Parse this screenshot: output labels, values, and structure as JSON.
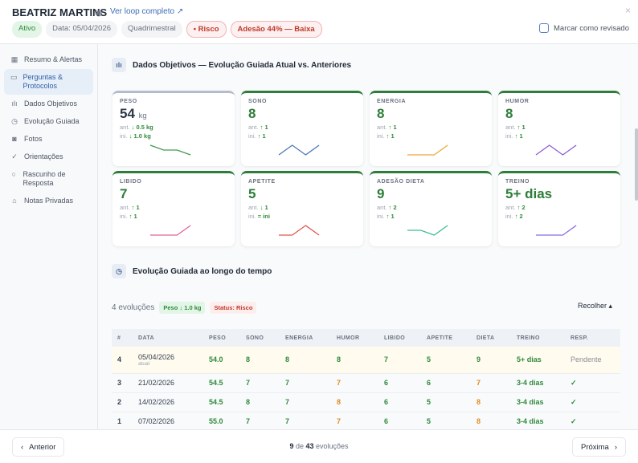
{
  "header": {
    "name": "BEATRIZ MARTINS",
    "loop_link": "Ver loop completo ↗",
    "badges": [
      {
        "text": "Ativo",
        "kind": "g"
      },
      {
        "text": "Data: 05/04/2026",
        "kind": ""
      },
      {
        "text": "Quadrimestral",
        "kind": ""
      },
      {
        "text": "• Risco",
        "kind": "r"
      },
      {
        "text": "Adesão 44% — Baixa",
        "kind": "r"
      }
    ],
    "review_label": "Marcar como revisado",
    "close": "×"
  },
  "sidebar": {
    "items": [
      {
        "icon": "calendar",
        "glyph": "▦",
        "label": "Resumo & Alertas"
      },
      {
        "icon": "message",
        "glyph": "▭",
        "label": "Perguntas & Protocolos",
        "active": true
      },
      {
        "icon": "bar-chart",
        "glyph": "ılı",
        "label": "Dados Objetivos"
      },
      {
        "icon": "clock",
        "glyph": "◷",
        "label": "Evolução Guiada"
      },
      {
        "icon": "camera",
        "glyph": "◙",
        "label": "Fotos"
      },
      {
        "icon": "check-circle",
        "glyph": "✓",
        "label": "Orientações"
      },
      {
        "icon": "chat",
        "glyph": "○",
        "label": "Rascunho de Resposta"
      },
      {
        "icon": "lock",
        "glyph": "⌂",
        "label": "Notas Privadas"
      }
    ]
  },
  "section1": {
    "title": "Dados Objetivos — Evolução Guiada Atual vs. Anteriores"
  },
  "cards": [
    {
      "label": "PESO",
      "value": "54",
      "unit": "kg",
      "ant": "↓ 0.5 kg",
      "ini": "↓ 1.0 kg",
      "color": "#3f9a52",
      "trend": [
        55.0,
        54.5,
        54.5,
        54.0
      ],
      "neutral": true
    },
    {
      "label": "SONO",
      "value": "8",
      "unit": "",
      "ant": "↑ 1",
      "ini": "↑ 1",
      "color": "#4a78b5",
      "trend": [
        7,
        8,
        7,
        8
      ]
    },
    {
      "label": "ENERGIA",
      "value": "8",
      "unit": "",
      "ant": "↑ 1",
      "ini": "↑ 1",
      "color": "#eaa93a",
      "trend": [
        7,
        7,
        7,
        8
      ]
    },
    {
      "label": "HUMOR",
      "value": "8",
      "unit": "",
      "ant": "↑ 1",
      "ini": "↑ 1",
      "color": "#8b5cd6",
      "trend": [
        7,
        8,
        7,
        8
      ]
    },
    {
      "label": "LIBIDO",
      "value": "7",
      "unit": "",
      "ant": "↑ 1",
      "ini": "↑ 1",
      "color": "#e2659a",
      "trend": [
        6,
        6,
        6,
        7
      ]
    },
    {
      "label": "APETITE",
      "value": "5",
      "unit": "",
      "ant": "↓ 1",
      "ini": "= ini",
      "color": "#e0584f",
      "trend": [
        5,
        5,
        6,
        5
      ]
    },
    {
      "label": "ADESÃO DIETA",
      "value": "9",
      "unit": "",
      "ant": "↑ 2",
      "ini": "↑ 1",
      "color": "#3cbf95",
      "trend": [
        8,
        8,
        7,
        9
      ]
    },
    {
      "label": "TREINO",
      "value": "5+ dias",
      "unit": "",
      "ant": "↑ 2",
      "ini": "↑ 2",
      "color": "#8b6ae0",
      "trend": [
        3,
        3,
        3,
        5
      ]
    }
  ],
  "delta_labels": {
    "ant": "ant.",
    "ini": "ini."
  },
  "section2": {
    "title": "Evolução Guiada ao longo do tempo",
    "count": "4 evoluções",
    "pill_weight": "Peso ↓ 1.0 kg",
    "pill_status": "Status: Risco",
    "collapse": "Recolher ▴"
  },
  "table": {
    "headers": [
      "#",
      "DATA",
      "PESO",
      "SONO",
      "ENERGIA",
      "HUMOR",
      "LIBIDO",
      "APETITE",
      "DIETA",
      "TREINO",
      "RESP."
    ],
    "rows": [
      {
        "n": "4",
        "date": "05/04/2026",
        "sub": "atual",
        "cells": [
          "54.0",
          "8",
          "8",
          "8",
          "7",
          "5",
          "9",
          "5+ dias"
        ],
        "resp": "Pendente",
        "current": true
      },
      {
        "n": "3",
        "date": "21/02/2026",
        "cells": [
          "54.5",
          "7",
          "7",
          "7",
          "6",
          "6",
          "7",
          "3-4 dias"
        ],
        "resp": "✓"
      },
      {
        "n": "2",
        "date": "14/02/2026",
        "cells": [
          "54.5",
          "8",
          "7",
          "8",
          "6",
          "5",
          "8",
          "3-4 dias"
        ],
        "resp": "✓"
      },
      {
        "n": "1",
        "date": "07/02/2026",
        "cells": [
          "55.0",
          "7",
          "7",
          "7",
          "6",
          "5",
          "8",
          "3-4 dias"
        ],
        "resp": "✓"
      }
    ],
    "orange_cols": [
      4,
      7
    ]
  },
  "footer": {
    "prev": "Anterior",
    "next": "Próxima",
    "current": "9",
    "of": "de",
    "total": "43",
    "suffix": "evoluções"
  }
}
